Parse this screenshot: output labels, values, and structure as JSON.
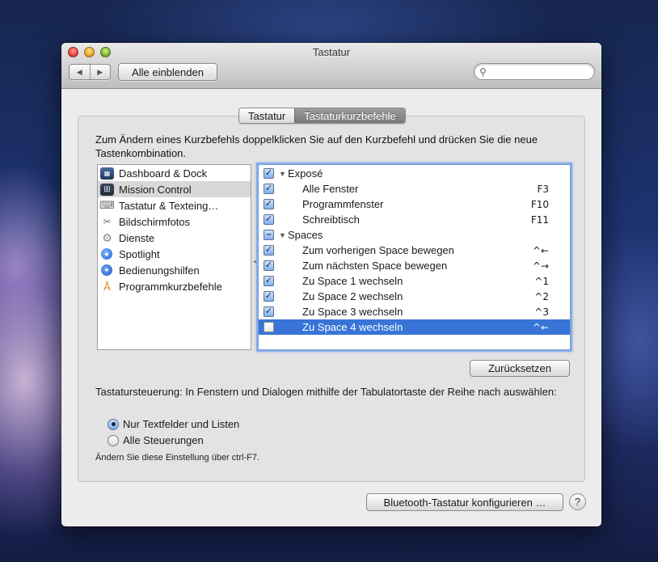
{
  "window": {
    "title": "Tastatur"
  },
  "toolbar": {
    "back_icon": "◀",
    "forward_icon": "▶",
    "show_all_label": "Alle einblenden",
    "search_placeholder": "",
    "search_value": ""
  },
  "tabs": [
    {
      "label": "Tastatur",
      "active": false
    },
    {
      "label": "Tastaturkurzbefehle",
      "active": true
    }
  ],
  "description": "Zum Ändern eines Kurzbefehls doppelklicken Sie auf den Kurzbefehl und drücken Sie die neue Tastenkombination.",
  "categories": [
    {
      "label": "Dashboard & Dock",
      "icon": "dashboard-icon"
    },
    {
      "label": "Mission Control",
      "icon": "mission-control-icon"
    },
    {
      "label": "Tastatur & Texteing…",
      "icon": "keyboard-icon"
    },
    {
      "label": "Bildschirmfotos",
      "icon": "screenshot-icon"
    },
    {
      "label": "Dienste",
      "icon": "gear-icon"
    },
    {
      "label": "Spotlight",
      "icon": "spotlight-icon"
    },
    {
      "label": "Bedienungshilfen",
      "icon": "accessibility-icon"
    },
    {
      "label": "Programmkurzbefehle",
      "icon": "app-shortcuts-icon"
    }
  ],
  "shortcuts": [
    {
      "name": "Exposé",
      "key": "",
      "group": true,
      "check": "checked"
    },
    {
      "name": "Alle Fenster",
      "key": "F3",
      "group": false,
      "check": "checked"
    },
    {
      "name": "Programmfenster",
      "key": "F10",
      "group": false,
      "check": "checked"
    },
    {
      "name": "Schreibtisch",
      "key": "F11",
      "group": false,
      "check": "checked"
    },
    {
      "name": "Spaces",
      "key": "",
      "group": true,
      "check": "mixed"
    },
    {
      "name": "Zum vorherigen Space bewegen",
      "key": "^←",
      "group": false,
      "check": "checked"
    },
    {
      "name": "Zum nächsten Space bewegen",
      "key": "^→",
      "group": false,
      "check": "checked"
    },
    {
      "name": "Zu Space 1 wechseln",
      "key": "^1",
      "group": false,
      "check": "checked"
    },
    {
      "name": "Zu Space 2 wechseln",
      "key": "^2",
      "group": false,
      "check": "checked"
    },
    {
      "name": "Zu Space 3 wechseln",
      "key": "^3",
      "group": false,
      "check": "checked"
    },
    {
      "name": "Zu Space 4 wechseln",
      "key": "^←",
      "group": false,
      "check": "unchecked",
      "selected": true
    }
  ],
  "reset_label": "Zurücksetzen",
  "keyboard_control": {
    "text": "Tastatursteuerung: In Fenstern und Dialogen mithilfe der Tabulatortaste der Reihe nach auswählen:",
    "options": [
      {
        "label": "Nur Textfelder und Listen",
        "selected": true
      },
      {
        "label": "Alle Steuerungen",
        "selected": false
      }
    ],
    "hint": "Ändern Sie diese Einstellung über ctrl-F7."
  },
  "bluetooth_label": "Bluetooth-Tastatur konfigurieren …",
  "help_label": "?"
}
